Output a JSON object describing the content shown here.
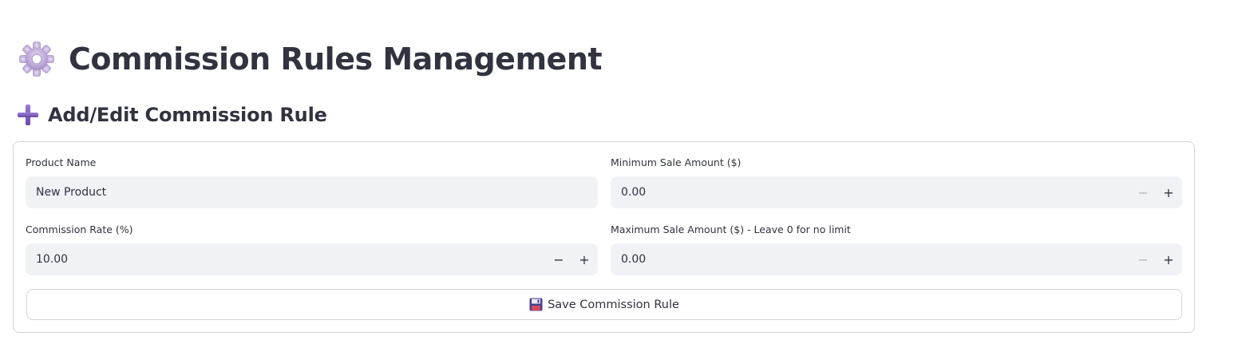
{
  "header": {
    "title": "Commission Rules Management",
    "icon": "gear-icon"
  },
  "section": {
    "title": "Add/Edit Commission Rule",
    "icon": "plus-icon"
  },
  "form": {
    "product_name": {
      "label": "Product Name",
      "value": "New Product"
    },
    "min_sale_amount": {
      "label": "Minimum Sale Amount ($)",
      "value": "0.00",
      "minus": "−",
      "plus": "+"
    },
    "commission_rate": {
      "label": "Commission Rate (%)",
      "value": "10.00",
      "minus": "−",
      "plus": "+"
    },
    "max_sale_amount": {
      "label": "Maximum Sale Amount ($) - Leave 0 for no limit",
      "value": "0.00",
      "minus": "−",
      "plus": "+"
    },
    "save_button": {
      "label": "Save Commission Rule",
      "icon": "floppy-disk-icon"
    }
  },
  "colors": {
    "text": "#31333f",
    "input_bg": "#f0f2f6",
    "border": "#d6d6d9",
    "accent_purple": "#7d5bbe"
  }
}
